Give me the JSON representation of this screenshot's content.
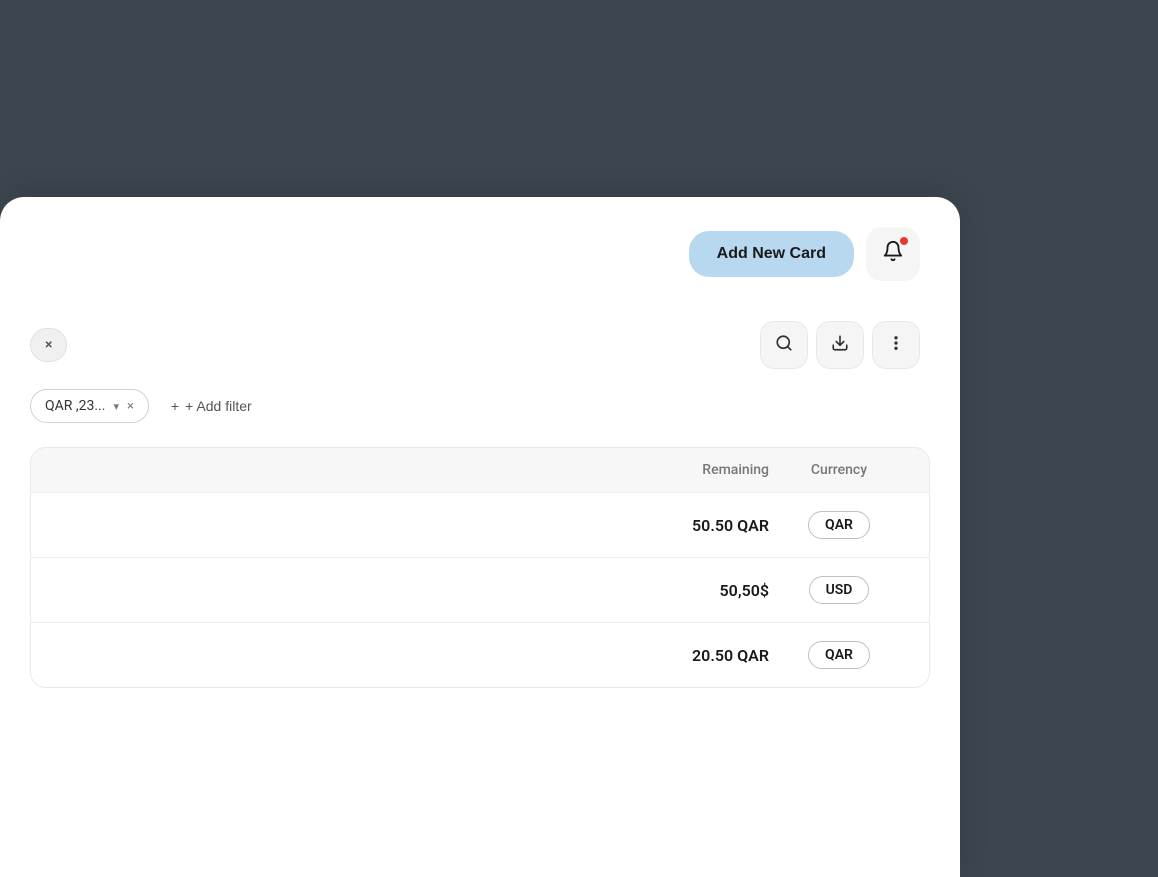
{
  "header": {
    "add_new_card_label": "Add New Card",
    "notification_badge": true
  },
  "toolbar": {
    "close_chip_label": "×",
    "search_icon": "search",
    "download_icon": "download",
    "more_icon": "more"
  },
  "filters": {
    "active_filter_label": "QAR ,23...",
    "add_filter_label": "+ Add filter"
  },
  "table": {
    "columns": [
      {
        "key": "empty",
        "label": ""
      },
      {
        "key": "remaining",
        "label": "Remaining"
      },
      {
        "key": "currency",
        "label": "Currency"
      }
    ],
    "rows": [
      {
        "remaining": "50.50 QAR",
        "currency": "QAR"
      },
      {
        "remaining": "50,50$",
        "currency": "USD"
      },
      {
        "remaining": "20.50 QAR",
        "currency": "QAR"
      }
    ]
  }
}
